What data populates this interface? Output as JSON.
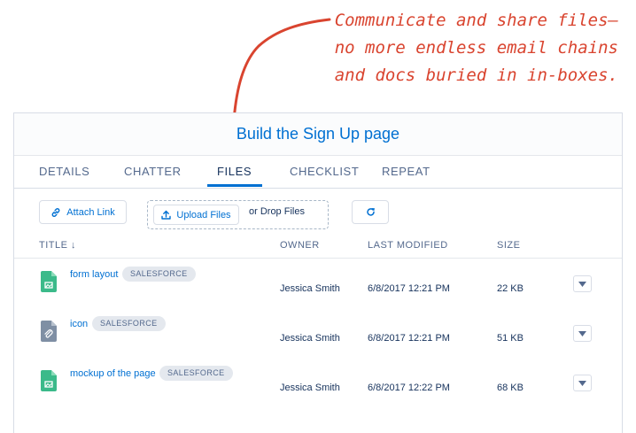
{
  "annotation": {
    "lines": [
      "Communicate and share files—",
      "no more endless email chains",
      "and docs buried in in-boxes."
    ],
    "color": "#d9442f"
  },
  "card": {
    "title": "Build the Sign Up page"
  },
  "tabs": [
    {
      "label": "DETAILS",
      "active": false
    },
    {
      "label": "CHATTER",
      "active": false
    },
    {
      "label": "FILES",
      "active": true
    },
    {
      "label": "CHECKLIST",
      "active": false
    },
    {
      "label": "REPEAT",
      "active": false
    }
  ],
  "toolbar": {
    "attach_label": "Attach Link",
    "attach_icon": "link-icon",
    "upload_label": "Upload Files",
    "upload_icon": "upload-icon",
    "drop_label": "or Drop Files",
    "refresh_icon": "refresh-icon"
  },
  "table": {
    "columns": [
      "TITLE",
      "OWNER",
      "LAST MODIFIED",
      "SIZE"
    ],
    "sort_icon": "arrow-down-icon",
    "rows": [
      {
        "name": "form layout",
        "tag": "SALESFORCE",
        "owner": "Jessica Smith",
        "modified": "6/8/2017 12:21 PM",
        "size": "22 KB",
        "icon": "image-file-icon",
        "icon_color": "#3bba8a"
      },
      {
        "name": "icon",
        "tag": "SALESFORCE",
        "owner": "Jessica Smith",
        "modified": "6/8/2017 12:21 PM",
        "size": "51 KB",
        "icon": "attachment-file-icon",
        "icon_color": "#7f8fa4"
      },
      {
        "name": "mockup of the page",
        "tag": "SALESFORCE",
        "owner": "Jessica Smith",
        "modified": "6/8/2017 12:22 PM",
        "size": "68 KB",
        "icon": "image-file-icon",
        "icon_color": "#3bba8a"
      }
    ]
  },
  "colors": {
    "brand": "#0070d2",
    "text": "#16325c",
    "muted": "#54698d"
  }
}
